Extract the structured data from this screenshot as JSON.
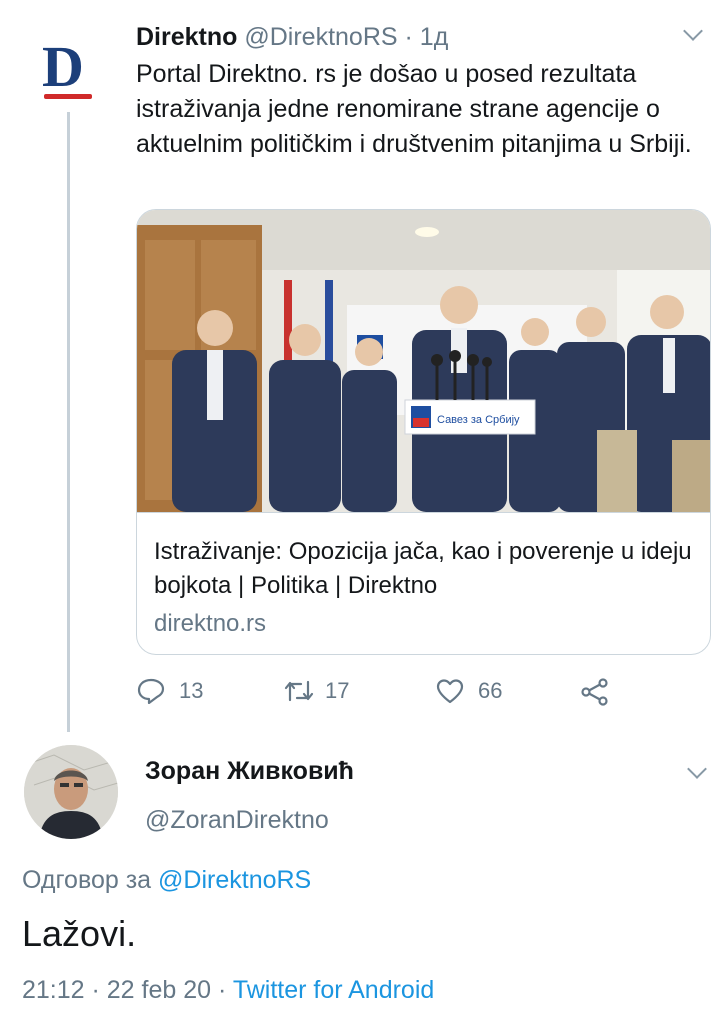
{
  "tweet": {
    "author_name": "Direktno",
    "author_handle": "@DirektnoRS",
    "separator": "·",
    "time": "1д",
    "logo_letter": "D",
    "text": "Portal Direktno. rs je došao u posed rezultata istraživanja jedne renomirane strane agencije o aktuelnim političkim i društvenim pitanjima u Srbiji.",
    "card": {
      "image_sign": "Савез за Србију",
      "title": "Istraživanje: Opozicija jača, kao i poverenje u ideju bojkota | Politika | Direktno",
      "domain": "direktno.rs"
    },
    "actions": {
      "replies": "13",
      "retweets": "17",
      "likes": "66"
    }
  },
  "reply": {
    "author_name": "Зоран Живковић",
    "author_handle": "@ZoranDirektno",
    "replying_prefix": "Одговор за",
    "replying_to": "@DirektnoRS",
    "text": "Lažovi.",
    "timestamp": "21:12 · 22 feb 20 ·",
    "source": "Twitter for Android"
  },
  "colors": {
    "link": "#1b95e0",
    "secondary_text": "#657786",
    "border": "#ccd6dd"
  }
}
